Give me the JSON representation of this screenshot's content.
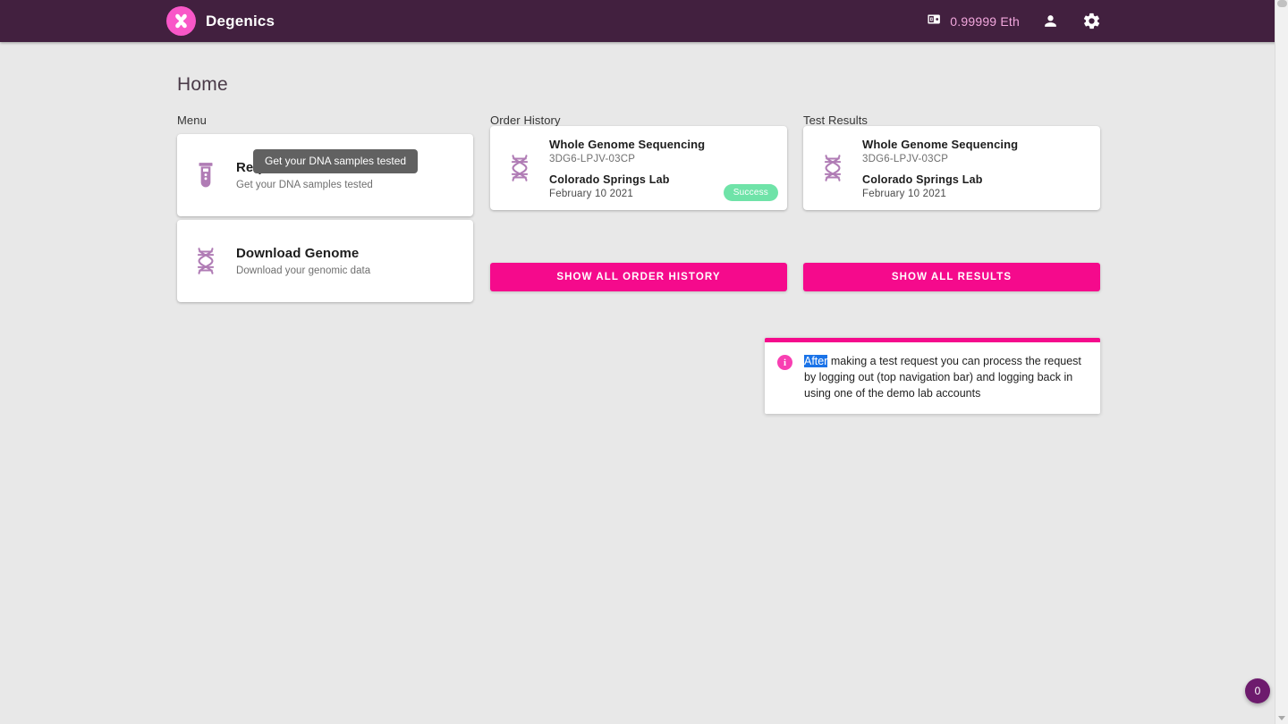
{
  "header": {
    "brand_name": "Degenics",
    "logo_icon": "chromosome-x-icon",
    "wallet_icon": "wallet-icon",
    "eth_balance": "0.99999 Eth",
    "account_icon": "person-icon",
    "settings_icon": "gear-icon"
  },
  "page": {
    "title": "Home"
  },
  "tooltip": {
    "text": "Get your DNA samples tested"
  },
  "menu": {
    "label": "Menu",
    "items": [
      {
        "icon": "test-tube-icon",
        "title": "Request Test",
        "subtitle": "Get your DNA samples tested"
      },
      {
        "icon": "dna-helix-icon",
        "title": "Download Genome",
        "subtitle": "Download your genomic data"
      }
    ]
  },
  "order_history": {
    "label": "Order History",
    "icon": "dna-helix-icon",
    "entry": {
      "title": "Whole Genome Sequencing",
      "code": "3DG6-LPJV-03CP",
      "lab": "Colorado Springs Lab",
      "date": "February 10 2021",
      "status": "Success"
    },
    "button_label": "SHOW ALL ORDER HISTORY"
  },
  "test_results": {
    "label": "Test Results",
    "icon": "dna-helix-icon",
    "entry": {
      "title": "Whole Genome Sequencing",
      "code": "3DG6-LPJV-03CP",
      "lab": "Colorado Springs Lab",
      "date": "February 10 2021"
    },
    "button_label": "SHOW ALL RESULTS"
  },
  "notification": {
    "icon": "info-icon",
    "selected_word": "After",
    "message": " making a test request you can process the request by logging out (top navigation bar) and logging back in using one of the demo lab accounts"
  },
  "floating_badge": {
    "count": "0"
  },
  "colors": {
    "header_bg": "#42203f",
    "page_bg": "#e8e8e8",
    "accent_pink": "#f50a8c",
    "logo_pink": "#f957c8",
    "success_green": "#6fe3a8",
    "icon_purple": "#b07cb5",
    "tooltip_gray": "#616161",
    "selection_blue": "#1a73e8",
    "badge_purple": "#6d1b6d"
  }
}
